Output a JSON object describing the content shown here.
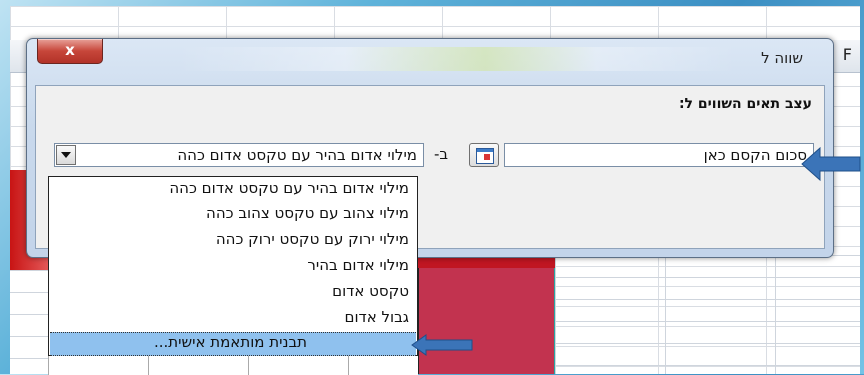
{
  "spreadsheet": {
    "column_letter": "F"
  },
  "dialog": {
    "title": "שווה ל",
    "close_label": "x",
    "heading": "עצב תאים השווים ל:",
    "cell_value": "סכום הקסם כאן",
    "with_label": "ב-",
    "format_selected": "מילוי אדום בהיר עם טקסט אדום כהה"
  },
  "dropdown": {
    "items": [
      "מילוי אדום בהיר עם טקסט אדום כהה",
      "מילוי צהוב עם טקסט צהוב כהה",
      "מילוי ירוק עם טקסט ירוק כהה",
      "מילוי אדום בהיר",
      "טקסט אדום",
      "גבול אדום",
      "תבנית מותאמת אישית..."
    ],
    "highlighted_index": 6
  },
  "colors": {
    "arrow": "#3b74b8",
    "highlight": "#8fc1ee",
    "close_button": "#c7463a"
  },
  "icons": [
    "close-icon",
    "range-selector-icon",
    "dropdown-arrow-icon",
    "pointer-arrow-icon"
  ]
}
